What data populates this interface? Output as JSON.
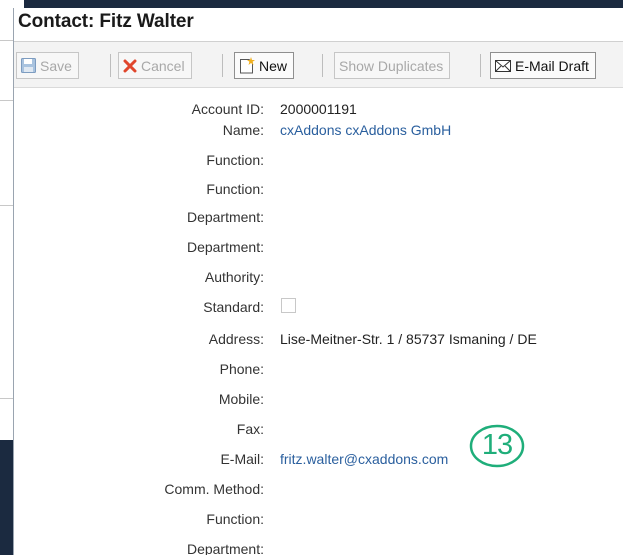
{
  "dialog": {
    "title": "Contact: Fitz Walter"
  },
  "toolbar": {
    "save_label": "Save",
    "cancel_label": "Cancel",
    "new_label": "New",
    "show_duplicates_label": "Show Duplicates",
    "email_draft_label": "E-Mail Draft"
  },
  "form": {
    "account_id_label": "Account ID:",
    "account_id_value": "2000001191",
    "name_label": "Name:",
    "name_value": "cxAddons cxAddons GmbH",
    "function1_label": "Function:",
    "function2_label": "Function:",
    "department1_label": "Department:",
    "department2_label": "Department:",
    "authority_label": "Authority:",
    "standard_label": "Standard:",
    "address_label": "Address:",
    "address_value": "Lise-Meitner-Str. 1 / 85737 Ismaning / DE",
    "phone_label": "Phone:",
    "mobile_label": "Mobile:",
    "fax_label": "Fax:",
    "email_label": "E-Mail:",
    "email_value": "fritz.walter@cxaddons.com",
    "comm_method_label": "Comm. Method:",
    "function3_label": "Function:",
    "department3_label": "Department:"
  },
  "annotation": {
    "number": "13",
    "color": "#1fae7a"
  },
  "colors": {
    "link": "#2a5f9e",
    "background_dark": "#1b2a40",
    "cancel_icon": "#e0462c",
    "new_icon": "#f0b020"
  }
}
